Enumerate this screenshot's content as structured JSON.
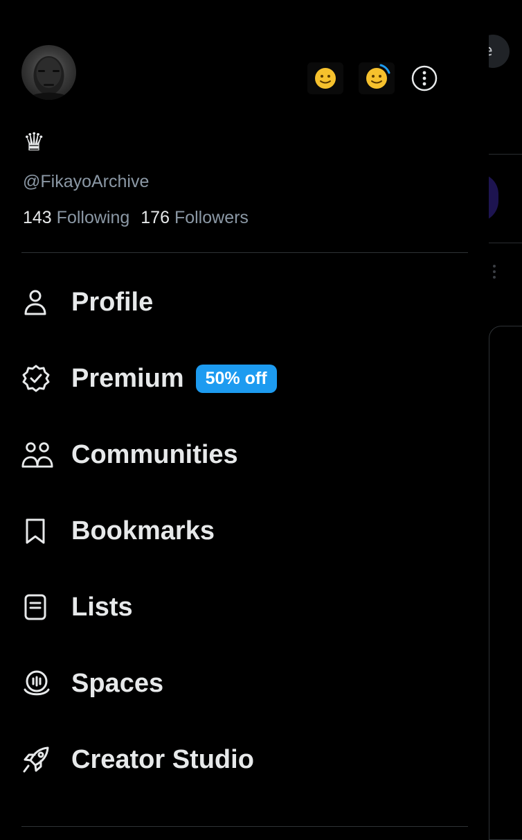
{
  "background": {
    "chip_text": "e"
  },
  "profile": {
    "badge_glyph": "♛",
    "handle": "@FikayoArchive",
    "following_count": "143",
    "following_label": "Following",
    "followers_count": "176",
    "followers_label": "Followers"
  },
  "header": {
    "account_icons": [
      "smiley-face-icon",
      "smiley-face-icon"
    ],
    "more_icon": "more-options-icon"
  },
  "menu": {
    "items": [
      {
        "label": "Profile",
        "icon": "person-icon"
      },
      {
        "label": "Premium",
        "icon": "verified-badge-icon",
        "badge": "50% off"
      },
      {
        "label": "Communities",
        "icon": "communities-icon"
      },
      {
        "label": "Bookmarks",
        "icon": "bookmark-icon"
      },
      {
        "label": "Lists",
        "icon": "list-icon"
      },
      {
        "label": "Spaces",
        "icon": "spaces-icon"
      },
      {
        "label": "Creator Studio",
        "icon": "rocket-icon"
      }
    ]
  },
  "colors": {
    "accent": "#1d9bf0",
    "background": "#000000",
    "text_primary": "#e7e9ea",
    "text_secondary": "#8b98a5"
  }
}
